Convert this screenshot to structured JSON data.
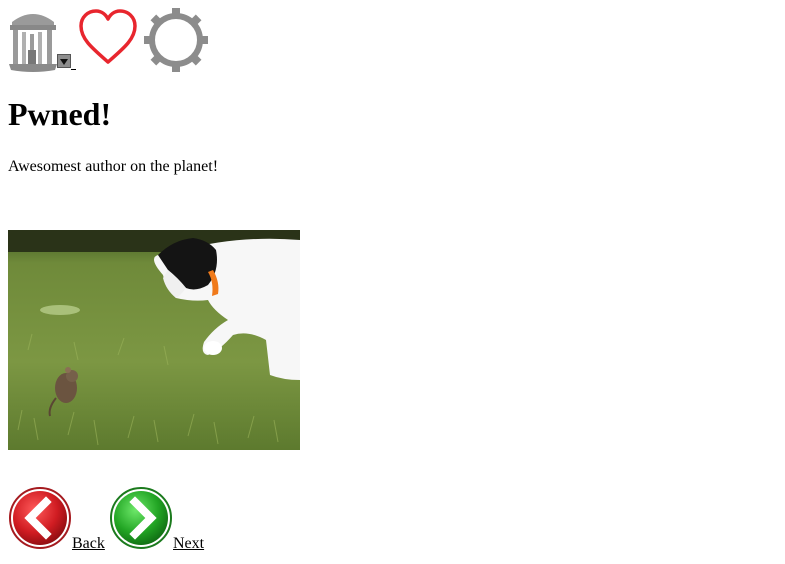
{
  "header": {
    "logo_icon": "old-well-icon",
    "dropdown_icon": "triangle-down-icon",
    "favorite_icon": "heart-outline-icon",
    "settings_icon": "gear-icon",
    "heart_color": "#e8262e",
    "gear_color": "#8c8c8c"
  },
  "main": {
    "title": "Pwned!",
    "subtitle": "Awesomest author on the planet!",
    "image_icon": "cat-and-mouse-photo"
  },
  "navigation": {
    "back_label": "Back",
    "next_label": "Next",
    "back_icon": "chevron-left-icon",
    "next_icon": "chevron-right-icon",
    "back_color": "#c4141a",
    "next_color": "#1f9a1f"
  }
}
